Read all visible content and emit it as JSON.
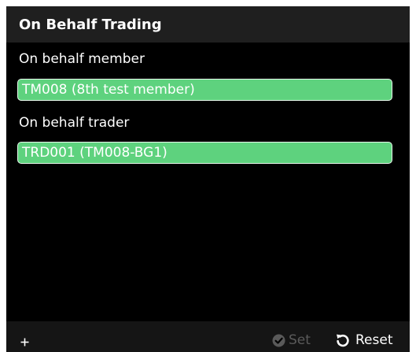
{
  "title": "On Behalf Trading",
  "member": {
    "label": "On behalf member",
    "value": "TM008 (8th test member)"
  },
  "trader": {
    "label": "On behalf trader",
    "value": "TRD001 (TM008-BG1)"
  },
  "footer": {
    "add_icon": "plus-icon",
    "set_label": "Set",
    "set_icon": "check-circle-icon",
    "reset_label": "Reset",
    "reset_icon": "undo-icon"
  },
  "colors": {
    "panel_background": "#000000",
    "title_bar": "#1f1f1f",
    "field_fill": "#5ed27e",
    "disabled_text": "#5a5a5a"
  }
}
